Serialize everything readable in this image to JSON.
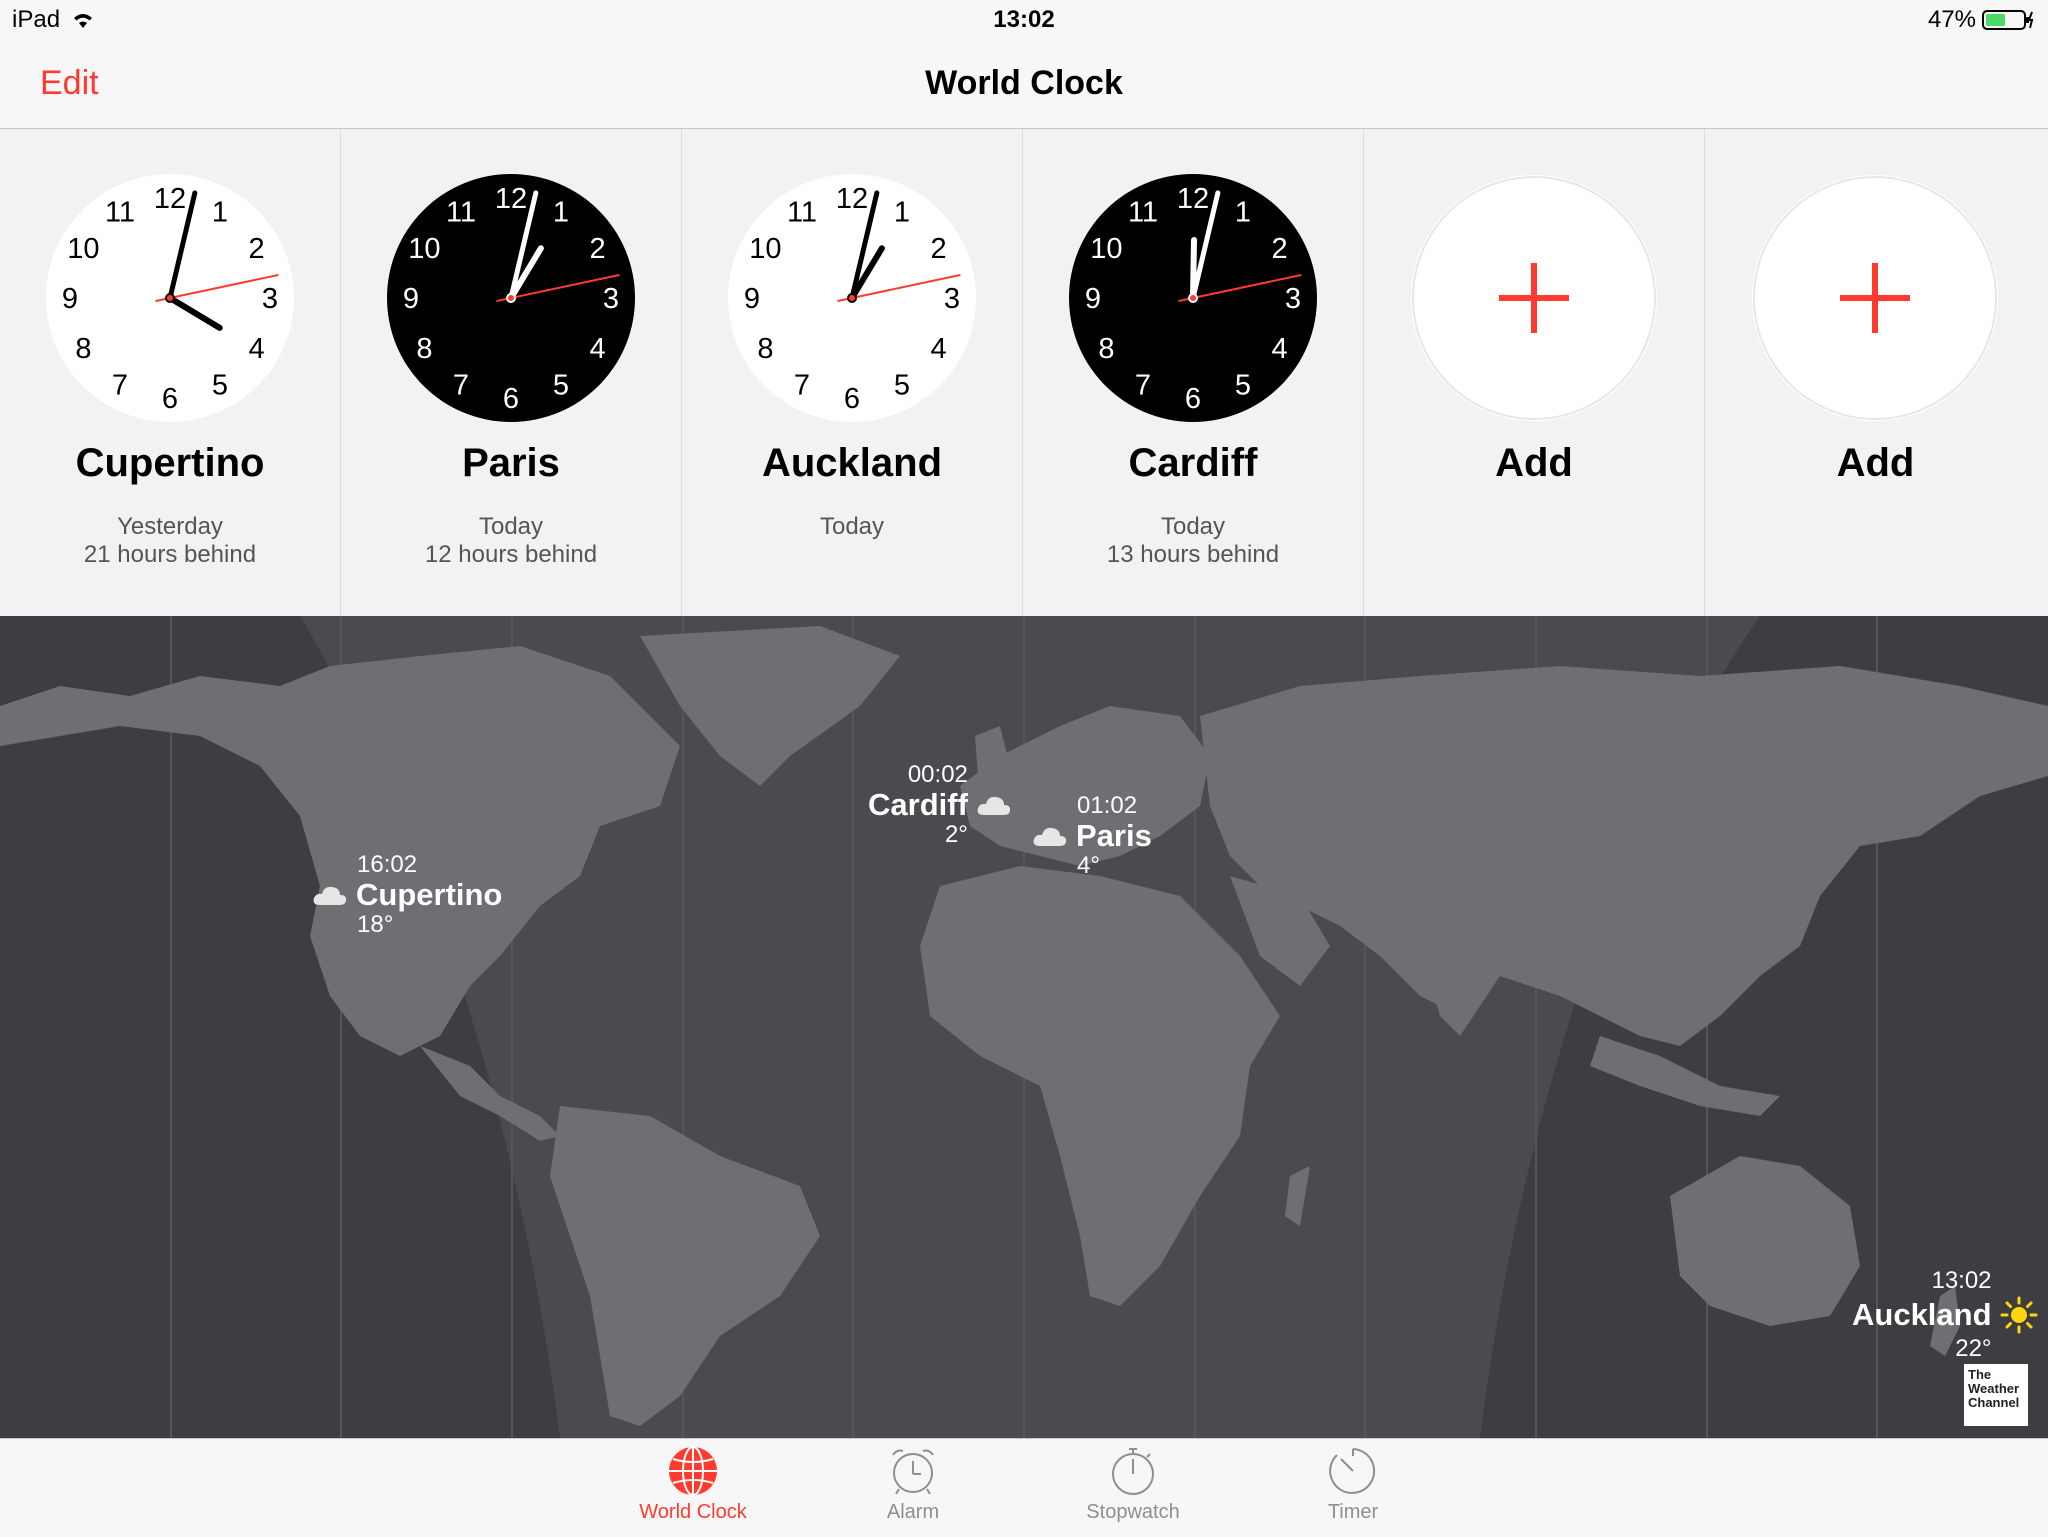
{
  "status": {
    "device": "iPad",
    "time": "13:02",
    "battery": "47%"
  },
  "nav": {
    "edit_label": "Edit",
    "title": "World Clock"
  },
  "clocks": [
    {
      "city": "Cupertino",
      "day": "Yesterday",
      "offset": "21 hours behind",
      "theme": "light",
      "hour": 16,
      "minute": 2,
      "second": 13
    },
    {
      "city": "Paris",
      "day": "Today",
      "offset": "12 hours behind",
      "theme": "dark",
      "hour": 1,
      "minute": 2,
      "second": 13
    },
    {
      "city": "Auckland",
      "day": "Today",
      "offset": "",
      "theme": "light",
      "hour": 13,
      "minute": 2,
      "second": 13
    },
    {
      "city": "Cardiff",
      "day": "Today",
      "offset": "13 hours behind",
      "theme": "dark",
      "hour": 0,
      "minute": 2,
      "second": 13
    }
  ],
  "add_slots": [
    {
      "label": "Add"
    },
    {
      "label": "Add"
    }
  ],
  "map": {
    "cities": [
      {
        "name": "Cupertino",
        "time": "16:02",
        "temp": "18°",
        "weather": "cloud-icon"
      },
      {
        "name": "Cardiff",
        "time": "00:02",
        "temp": "2°",
        "weather": "cloud-icon"
      },
      {
        "name": "Paris",
        "time": "01:02",
        "temp": "4°",
        "weather": "cloud-icon"
      },
      {
        "name": "Auckland",
        "time": "13:02",
        "temp": "22°",
        "weather": "sun-icon"
      }
    ],
    "attribution": [
      "The",
      "Weather",
      "Channel"
    ]
  },
  "tabs": [
    {
      "label": "World Clock",
      "icon": "globe-icon",
      "active": true
    },
    {
      "label": "Alarm",
      "icon": "alarm-clock-icon",
      "active": false
    },
    {
      "label": "Stopwatch",
      "icon": "stopwatch-icon",
      "active": false
    },
    {
      "label": "Timer",
      "icon": "timer-icon",
      "active": false
    }
  ],
  "colors": {
    "accent": "#ff3b30",
    "map_bg": "#3e3e42",
    "land": "#6e6e73"
  }
}
